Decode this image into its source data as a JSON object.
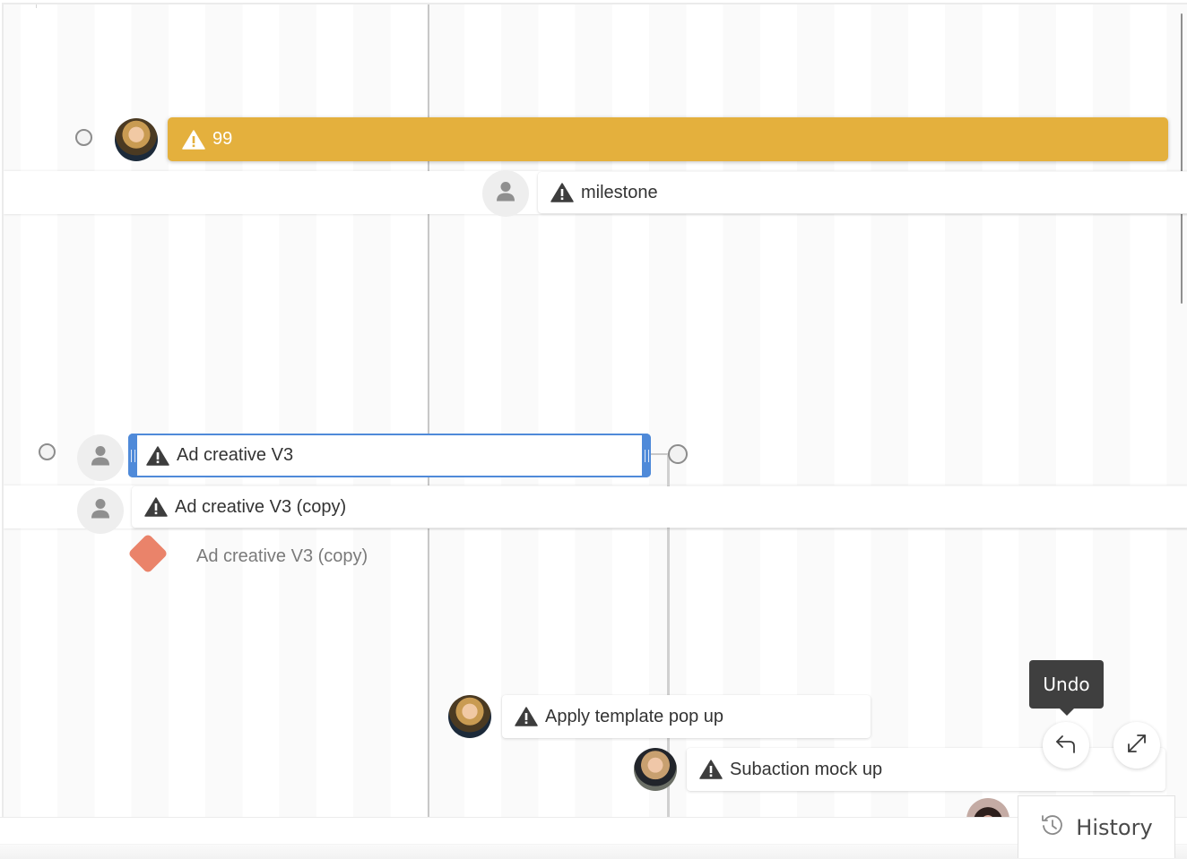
{
  "timeline": {
    "accent_color": "#4f8ad9",
    "warning_bar_color": "#e4b03d",
    "milestone_color": "#ea836a",
    "items": [
      {
        "id": "item-99",
        "label": "99",
        "assignee": "photo",
        "status": "warning",
        "style": "highlighted"
      },
      {
        "id": "item-milestone",
        "label": "milestone",
        "assignee": "unassigned",
        "status": "warning"
      },
      {
        "id": "item-ad-creative-v3",
        "label": "Ad creative V3",
        "assignee": "unassigned",
        "status": "warning",
        "selected": true
      },
      {
        "id": "item-ad-creative-v3-copy",
        "label": "Ad creative V3 (copy)",
        "assignee": "unassigned",
        "status": "warning"
      },
      {
        "id": "milestone-ad-creative-v3-copy",
        "label": "Ad creative V3 (copy)",
        "type": "milestone"
      },
      {
        "id": "item-apply-template",
        "label": "Apply template pop up",
        "assignee": "photo",
        "status": "warning"
      },
      {
        "id": "item-subaction",
        "label": "Subaction mock up",
        "assignee": "photo",
        "status": "warning"
      }
    ]
  },
  "controls": {
    "undo_tooltip": "Undo",
    "history_label": "History",
    "undo_icon": "undo-arrow-icon",
    "expand_icon": "expand-diagonal-icon",
    "history_icon": "history-clock-icon"
  }
}
